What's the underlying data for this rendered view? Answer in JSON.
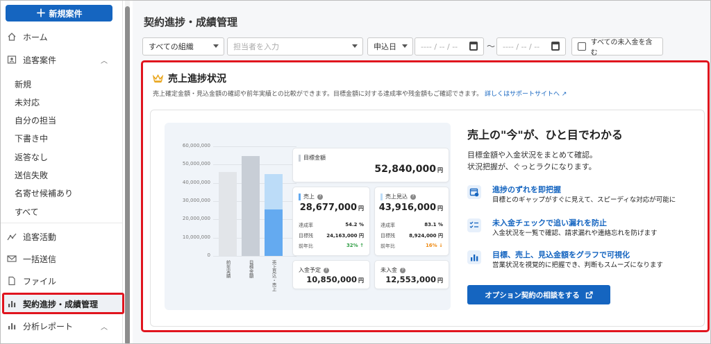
{
  "sidebar": {
    "new_button": "新規案件",
    "home": "ホーム",
    "tracking_cases": "追客案件",
    "sub_items": [
      "新規",
      "未対応",
      "自分の担当",
      "下書き中",
      "返答なし",
      "送信失敗",
      "名寄せ候補あり",
      "すべて"
    ],
    "tracking_activity": "追客活動",
    "bulk_send": "一括送信",
    "files": "ファイル",
    "contract_progress": "契約進捗・成績管理",
    "analysis_report": "分析レポート"
  },
  "header": {
    "title": "契約進捗・成績管理"
  },
  "filters": {
    "organization": "すべての組織",
    "assignee_placeholder": "担当者を入力",
    "date_type": "申込日",
    "date_from": "---- / -- / --",
    "tilde": "～",
    "date_to": "---- / -- / --",
    "include_unpaid": "すべての未入金を含む"
  },
  "panel": {
    "title": "売上進捗状況",
    "description": "売上確定金額・見込金額の確認や前年実績との比較ができます。目標金額に対する達成率や残金額もご確認できます。",
    "link": "詳しくはサポートサイトへ"
  },
  "illustration": {
    "chart_data": {
      "type": "bar",
      "title": "",
      "categories": [
        "前年実績",
        "目標金額",
        "売上見込・売上"
      ],
      "series": [
        {
          "values": [
            46000000,
            54500000,
            25500000
          ]
        },
        {
          "values": [
            0,
            0,
            19500000
          ]
        }
      ],
      "ylim": [
        0,
        60000000
      ],
      "y_ticks": [
        "60,000,000",
        "50,000,000",
        "40,000,000",
        "30,000,000",
        "20,000,000",
        "10,000,000",
        "0"
      ],
      "x_labels": [
        "前年実績",
        "目標金額",
        "売上見込・売上"
      ]
    },
    "target": {
      "label": "目標金額",
      "value": "52,840,000",
      "unit": "円"
    },
    "sales": {
      "label": "売上",
      "value": "28,677,000",
      "unit": "円",
      "rate_label": "達成率",
      "rate": "54.2 %",
      "remain_label": "目標残",
      "remain": "24,163,000 円",
      "yoy_label": "前年比",
      "yoy": "32% ↑"
    },
    "forecast": {
      "label": "売上見込",
      "value": "43,916,000",
      "unit": "円",
      "rate_label": "達成率",
      "rate": "83.1 %",
      "remain_label": "目標残",
      "remain": "8,924,000 円",
      "yoy_label": "前年比",
      "yoy": "16% ↓"
    },
    "planned": {
      "label": "入金予定",
      "value": "10,850,000",
      "unit": "円"
    },
    "unpaid": {
      "label": "未入金",
      "value": "12,553,000",
      "unit": "円"
    }
  },
  "promo": {
    "title": "売上の\"今\"が、ひと目でわかる",
    "sub1": "目標金額や入金状況をまとめて確認。",
    "sub2": "状況把握が、ぐっとラクになります。",
    "features": [
      {
        "title": "進捗のずれを即把握",
        "desc": "目標とのギャップがすぐに見えて、スピーディな対応が可能に",
        "icon": "calendar-alert-icon"
      },
      {
        "title": "未入金チェックで追い漏れを防止",
        "desc": "入金状況を一覧で確認、請求漏れや連絡忘れを防げます",
        "icon": "checklist-icon"
      },
      {
        "title": "目標、売上、見込金額をグラフで可視化",
        "desc": "営業状況を視覚的に把握でき、判断もスムーズになります",
        "icon": "bar-chart-icon"
      }
    ],
    "cta": "オプション契約の相談をする"
  },
  "colors": {
    "primary": "#1565c0",
    "highlight": "#e0141e",
    "bar_grey": "#e2e5e9",
    "bar_dark": "#c8ced6",
    "bar_blue": "#64aaf0",
    "bar_light_blue": "#bcdcf8",
    "up": "#2e9d43",
    "down": "#ef8a12"
  }
}
